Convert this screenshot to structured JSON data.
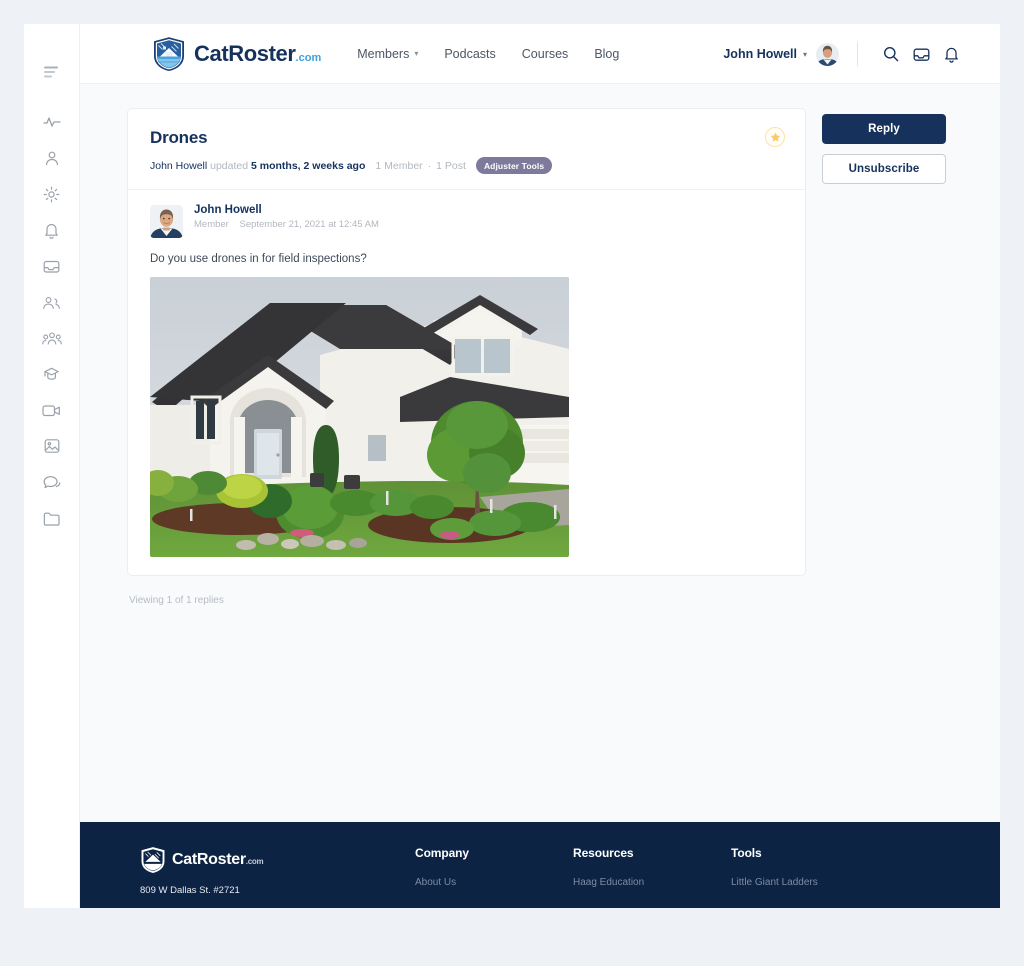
{
  "colors": {
    "page_bg": "#eef1f5",
    "content_bg": "#f9fafc",
    "brand_navy": "#16325c",
    "brand_blue": "#3ba3dd",
    "footer_navy": "#0d2344",
    "tag_purple": "#7d7a9c",
    "favorite_gold": "#ffc95c"
  },
  "rail": {
    "items": [
      {
        "name": "menu-collapse-icon",
        "label": "Collapse menu"
      },
      {
        "name": "activity-icon",
        "label": "Activity"
      },
      {
        "name": "profile-icon",
        "label": "Profile"
      },
      {
        "name": "settings-gear-icon",
        "label": "Settings"
      },
      {
        "name": "notifications-bell-icon",
        "label": "Notifications"
      },
      {
        "name": "inbox-icon",
        "label": "Messages"
      },
      {
        "name": "connections-icon",
        "label": "Connections"
      },
      {
        "name": "groups-icon",
        "label": "Groups"
      },
      {
        "name": "courses-cap-icon",
        "label": "Courses"
      },
      {
        "name": "video-icon",
        "label": "Videos"
      },
      {
        "name": "photos-icon",
        "label": "Photos"
      },
      {
        "name": "forums-chat-icon",
        "label": "Forums"
      },
      {
        "name": "documents-folder-icon",
        "label": "Documents"
      }
    ]
  },
  "header": {
    "brand": {
      "name_primary": "Cat",
      "name_secondary": "Roster",
      "suffix": ".com"
    },
    "nav": [
      {
        "label": "Members",
        "has_dropdown": true
      },
      {
        "label": "Podcasts",
        "has_dropdown": false
      },
      {
        "label": "Courses",
        "has_dropdown": false
      },
      {
        "label": "Blog",
        "has_dropdown": false
      }
    ],
    "user": {
      "name": "John Howell",
      "caret": "⌄"
    },
    "icons": [
      {
        "name": "search-icon",
        "label": "Search"
      },
      {
        "name": "inbox-icon",
        "label": "Inbox"
      },
      {
        "name": "bell-icon",
        "label": "Notifications"
      }
    ]
  },
  "topic": {
    "title": "Drones",
    "meta": {
      "author": "John Howell",
      "updated_word": "updated",
      "updated_time": "5 months, 2 weeks ago",
      "members": "1 Member",
      "separator": "·",
      "posts": "1 Post",
      "tag": "Adjuster Tools"
    },
    "favorite_icon": "star-icon"
  },
  "post": {
    "author": "John Howell",
    "role": "Member",
    "timestamp": "September 21, 2021 at 12:45 AM",
    "text": "Do you use drones in for field inspections?",
    "image_alt": "Two-story white stucco house with dark shingle roof and landscaped front yard"
  },
  "replies_note": "Viewing 1 of 1 replies",
  "actions": {
    "reply_label": "Reply",
    "unsubscribe_label": "Unsubscribe"
  },
  "footer": {
    "brand": {
      "name_primary": "Cat",
      "name_secondary": "Roster",
      "suffix": ".com"
    },
    "address": "809 W Dallas St. #2721",
    "columns": [
      {
        "heading": "Company",
        "links": [
          "About Us"
        ]
      },
      {
        "heading": "Resources",
        "links": [
          "Haag Education"
        ]
      },
      {
        "heading": "Tools",
        "links": [
          "Little Giant Ladders"
        ]
      }
    ]
  }
}
